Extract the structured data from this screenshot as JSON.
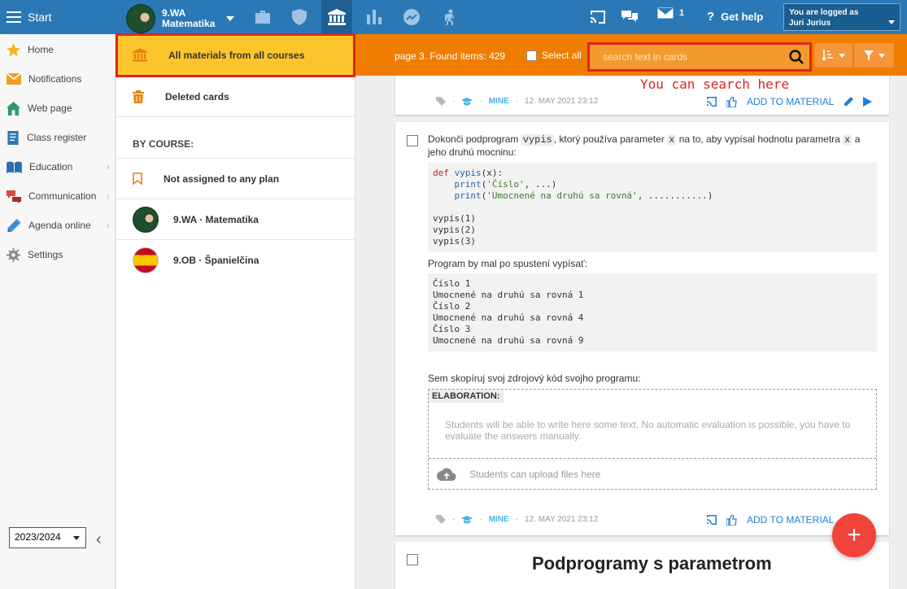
{
  "topbar": {
    "start_label": "Start",
    "course_class": "9.WA",
    "course_subject": "Matematika",
    "messages_count": "1",
    "help_label": "Get help",
    "logged_label": "You are logged as",
    "user_name": "Juri Jurius"
  },
  "sidebar": {
    "items": [
      {
        "label": "Home",
        "icon": "star-icon"
      },
      {
        "label": "Notifications",
        "icon": "envelope-icon"
      },
      {
        "label": "Web page",
        "icon": "house-icon"
      },
      {
        "label": "Class register",
        "icon": "register-icon"
      },
      {
        "label": "Education",
        "icon": "book-icon"
      },
      {
        "label": "Communication",
        "icon": "chat-icon"
      },
      {
        "label": "Agenda online",
        "icon": "pen-icon"
      },
      {
        "label": "Settings",
        "icon": "gear-icon"
      }
    ],
    "year": "2023/2024"
  },
  "panel": {
    "all_materials": "All materials from all courses",
    "deleted": "Deleted cards",
    "by_course": "BY COURSE:",
    "not_assigned": "Not assigned to any plan",
    "course1": "9.WA · Matematika",
    "course2": "9.OB · Španielčina"
  },
  "toolbar": {
    "found": "page 3. Found items: 429",
    "select_all": "Select all",
    "search_placeholder": "search text in cards",
    "hint": "You can search here"
  },
  "cards": {
    "meta_mine": "MINE",
    "date1": "12. MAY 2021 23:12",
    "date2": "12. MAY 2021 23:12",
    "add_label": "ADD TO MATERIAL",
    "q_part1": "Dokonči podprogram ",
    "q_code1": "vypis",
    "q_part2": ", ktorý používa parameter ",
    "q_code2": "x",
    "q_part3": " na to, aby vypísal hodnotu parametra ",
    "q_code3": "x",
    "q_part4": " a jeho druhú mocninu:",
    "output_intro": "Program by mal po spustení vypísať:",
    "output": "Číslo 1\nUmocnené na druhú sa rovná 1\nČíslo 2\nUmocnené na druhú sa rovná 4\nČíslo 3\nUmocnené na druhú sa rovná 9",
    "copy_prompt": "Sem skopíruj svoj zdrojový kód svojho programu:",
    "elaboration": "ELABORATION:",
    "elab_placeholder": "Students will be able to write here some text. No automatic evaluation is possible, you have to evaluate the answers manually.",
    "upload": "Students can upload files here",
    "next_title": "Podprogramy s parametrom"
  },
  "colors": {
    "topbar": "#2a79b6",
    "toolbar": "#f07d00",
    "selected": "#fdc52c",
    "highlight": "#e0251f",
    "fab": "#f0433a"
  }
}
